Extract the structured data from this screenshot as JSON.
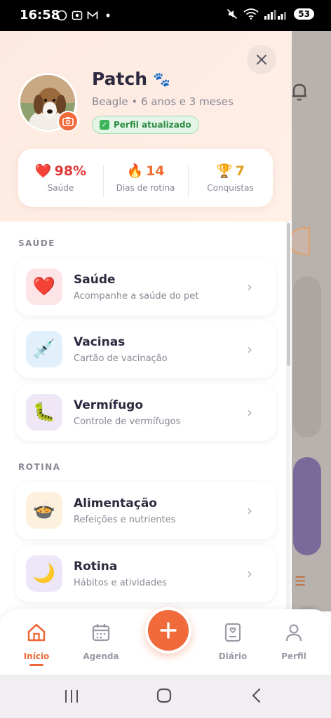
{
  "status_bar": {
    "time": "16:58",
    "battery": "53",
    "icons": [
      "whatsapp-icon",
      "screen-record-icon",
      "gmail-icon",
      "dot-icon",
      "mute-icon",
      "wifi-icon",
      "signal-icon"
    ]
  },
  "profile": {
    "name": "Patch",
    "name_emoji": "🐾",
    "subtitle": "Beagle • 6 anos e 3 meses",
    "badge": "Perfil atualizado"
  },
  "stats": [
    {
      "icon": "❤️",
      "value": "98%",
      "label": "Saúde",
      "color": "#e03838"
    },
    {
      "icon": "🔥",
      "value": "14",
      "label": "Dias de rotina",
      "color": "#ef6a2a"
    },
    {
      "icon": "🏆",
      "value": "7",
      "label": "Conquistas",
      "color": "#e0a020"
    }
  ],
  "sections": [
    {
      "label": "SAÚDE",
      "items": [
        {
          "icon": "❤️",
          "title": "Saúde",
          "subtitle": "Acompanhe a saúde do pet",
          "bg": "#fde4e6"
        },
        {
          "icon": "💉",
          "title": "Vacinas",
          "subtitle": "Cartão de vacinação",
          "bg": "#e2f0fb"
        },
        {
          "icon": "🐛",
          "title": "Vermífugo",
          "subtitle": "Controle de vermífugos",
          "bg": "#efe6f6"
        }
      ]
    },
    {
      "label": "ROTINA",
      "items": [
        {
          "icon": "🍲",
          "title": "Alimentação",
          "subtitle": "Refeições e nutrientes",
          "bg": "#fdf0dd"
        },
        {
          "icon": "🌙",
          "title": "Rotina",
          "subtitle": "Hábitos e atividades",
          "bg": "#ece6f6"
        }
      ]
    }
  ],
  "bottom_nav": [
    {
      "label": "Início",
      "icon": "home-icon",
      "active": true
    },
    {
      "label": "Agenda",
      "icon": "calendar-icon",
      "active": false
    },
    {
      "label": "Diário",
      "icon": "journal-icon",
      "active": false
    },
    {
      "label": "Perfil",
      "icon": "profile-icon",
      "active": false
    }
  ],
  "colors": {
    "accent": "#f06a3c",
    "active_nav": "#ef6a3a",
    "badge_green": "#2c8a42"
  }
}
